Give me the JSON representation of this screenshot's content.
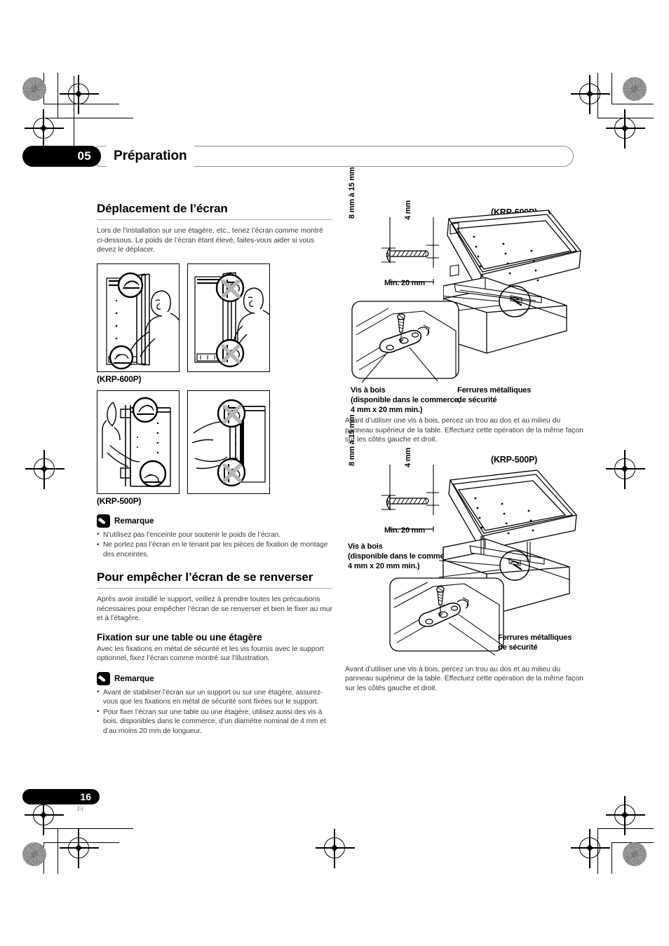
{
  "chapter": {
    "number": "05",
    "title": "Préparation"
  },
  "left": {
    "section1_title": "Déplacement de l’écran",
    "section1_intro": "Lors de l’installation sur une étagère, etc., tenez l’écran comme montré ci-dessous. Le poids de l’écran étant élevé, faites-vous aider si vous devez le déplacer.",
    "figure_label_600p": "(KRP-600P)",
    "figure_label_500p": "(KRP-500P)",
    "note1": {
      "title": "Remarque",
      "items": [
        "N’utilisez pas l’enceinte pour soutenir le poids de l’écran.",
        "Ne portez pas l’écran en le tenant par les pièces de fixation de montage des enceintes."
      ]
    },
    "section2_title": "Pour empêcher l’écran de se renverser",
    "section2_intro": "Après avoir installé le support, veillez à prendre toutes les précautions nécessaires pour empêcher l’écran de se renverser et bien le fixer au mur et à l’étagère.",
    "section2_sub": "Fixation sur une table ou une étagère",
    "section2_sub_text": "Avec les fixations en métal de sécurité et les vis fournis avec le support optionnel, fixez l’écran comme montré sur l’illustration.",
    "note2": {
      "title": "Remarque",
      "items": [
        "Avant de stabiliser l’écran sur un support ou sur une étagère, assurez-vous que les fixations en métal de sécurité sont fixées sur le support.",
        "Pour fixer l’écran sur une table ou une étagère, utilisez aussi des vis à bois, disponibles dans le commerce, d’un diamètre nominal de 4 mm et d’au moins 20 mm de longueur."
      ]
    }
  },
  "right": {
    "fig_600p": {
      "model": "(KRP-600P)",
      "dim_head_height": "8 mm à 15 mm",
      "dim_shank": "4 mm",
      "dim_length": "Min. 20 mm",
      "callout_screw_l1": "Vis à bois",
      "callout_screw_l2": "(disponible dans le commerce,",
      "callout_screw_l3": "4 mm x 20 mm min.)",
      "callout_bracket_l1": "Ferrures métalliques",
      "callout_bracket_l2": "de sécurité",
      "note": "Avant d’utiliser une vis à bois, percez un trou au dos et au milieu du panneau supérieur de la table. Effectuez cette opération de la même façon sur les côtés gauche et droit."
    },
    "fig_500p": {
      "model": "(KRP-500P)",
      "dim_head_height": "8 mm à 15 mm",
      "dim_shank": "4 mm",
      "dim_length": "Min. 20 mm",
      "callout_screw_l1": "Vis à bois",
      "callout_screw_l2": "(disponible dans le commerce,",
      "callout_screw_l3": "4 mm x 20 mm min.)",
      "callout_bracket_l1": "Ferrures  métalliques",
      "callout_bracket_l2": "de sécurité",
      "note": "Avant d’utiliser une vis à bois, percez un trou au dos et au milieu du panneau supérieur de la table. Effectuez cette opération de la même façon sur les côtés gauche et droit."
    }
  },
  "footer": {
    "page_number": "16",
    "language": "Fr"
  }
}
